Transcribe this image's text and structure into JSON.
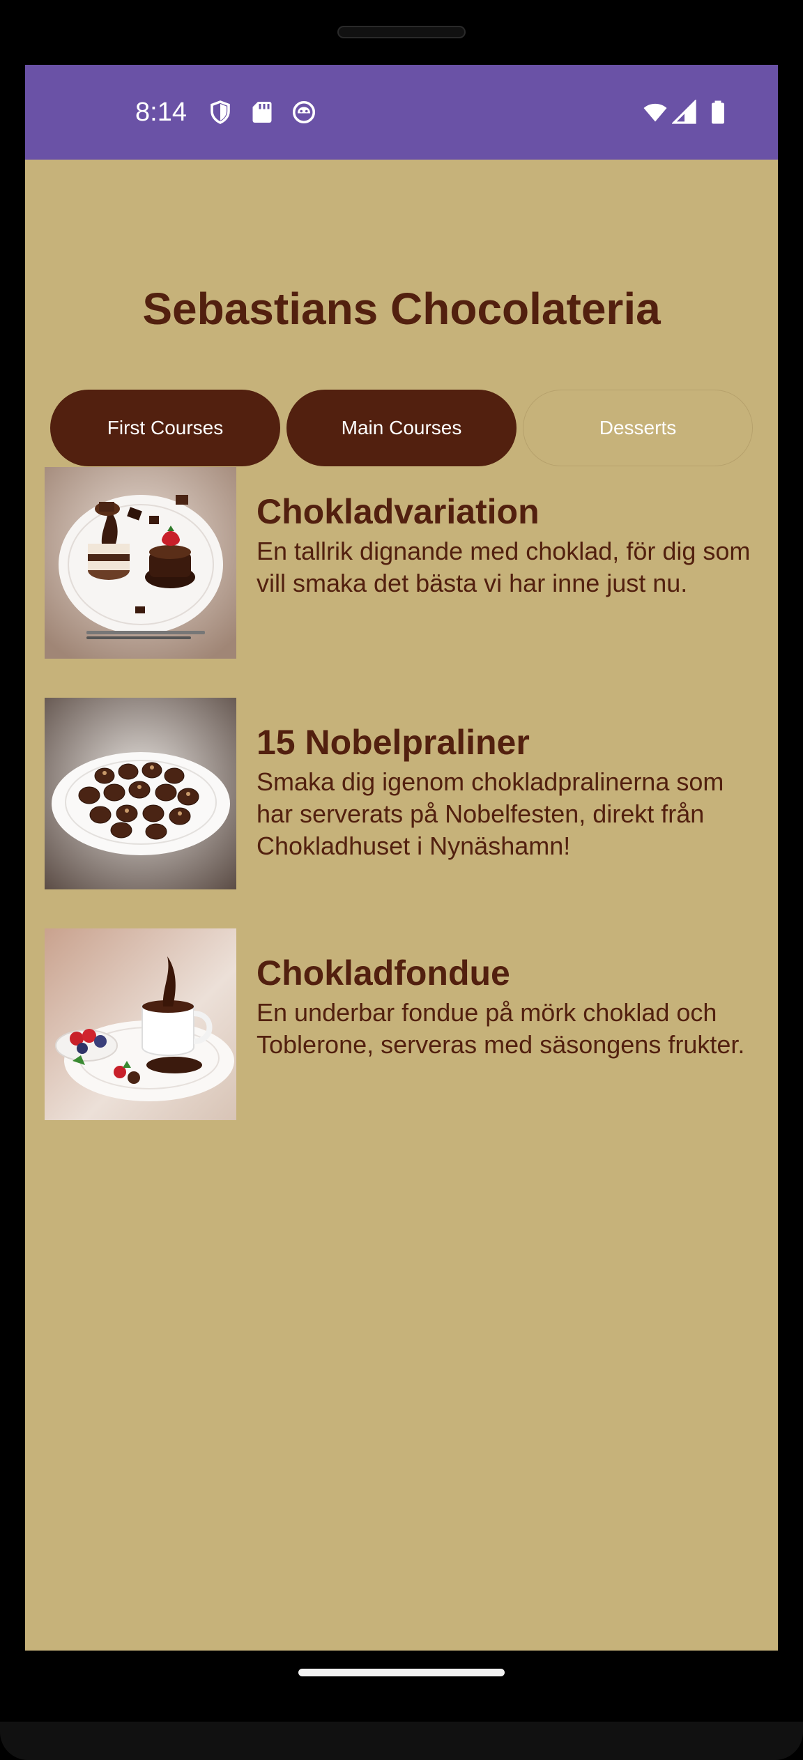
{
  "status_bar": {
    "time": "8:14",
    "left_icons": [
      "shield-icon",
      "sd-card-icon",
      "notification-face-icon"
    ],
    "right_icons": [
      "wifi-icon",
      "cell-signal-icon",
      "battery-icon"
    ],
    "background_color": "#6a52a6"
  },
  "app": {
    "title": "Sebastians Chocolateria",
    "background_color": "#c6b27a",
    "accent_color": "#52200f"
  },
  "tabs": [
    {
      "label": "First Courses",
      "style": "filled"
    },
    {
      "label": "Main Courses",
      "style": "filled"
    },
    {
      "label": "Desserts",
      "style": "outlined"
    }
  ],
  "menu_items": [
    {
      "name": "Chokladvariation",
      "description": "En tallrik dignande med choklad, för dig som vill smaka det bästa vi har inne just nu.",
      "image": "chocolate-variation-plate"
    },
    {
      "name": "15 Nobelpraliner",
      "description": "Smaka dig igenom chokladpralinerna som har serverats på Nobelfesten, direkt från Chokladhuset i Nynäshamn!",
      "image": "nobel-pralines-plate"
    },
    {
      "name": "Chokladfondue",
      "description": "En underbar fondue på mörk choklad och Toblerone, serveras med säsongens frukter.",
      "image": "chocolate-fondue-plate"
    }
  ]
}
